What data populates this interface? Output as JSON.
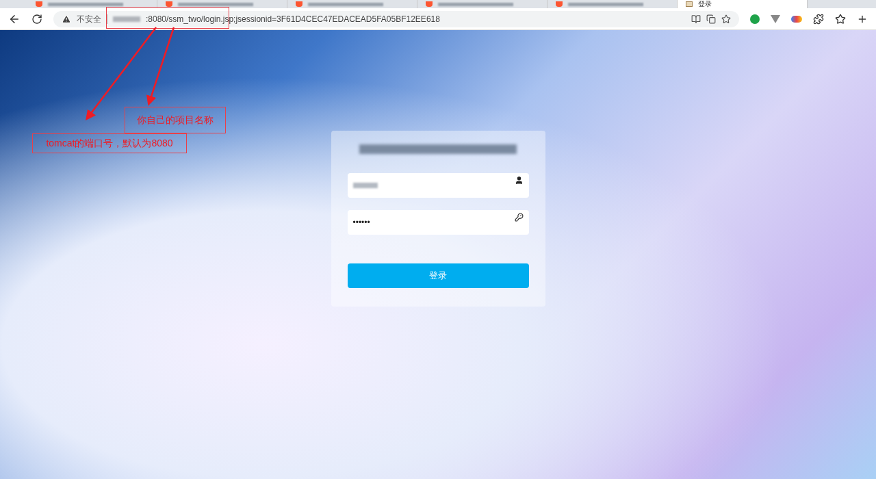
{
  "browser": {
    "tabs": [
      {
        "kind": "redacted",
        "selected": false
      },
      {
        "kind": "redacted",
        "selected": false
      },
      {
        "kind": "redacted",
        "selected": false
      },
      {
        "kind": "redacted",
        "selected": false
      },
      {
        "kind": "redacted",
        "selected": false
      },
      {
        "kind": "titled",
        "title": "登录",
        "selected": true
      }
    ],
    "security_label": "不安全",
    "url": ":8080/ssm_two/login.jsp;jsessionid=3F61D4CEC47EDACEAD5FA05BF12EE618"
  },
  "annotations": [
    {
      "text": "你自己的项目名称"
    },
    {
      "text": "tomcat的端口号，默认为8080"
    }
  ],
  "login": {
    "password_value": "••••••",
    "submit": "登录"
  }
}
